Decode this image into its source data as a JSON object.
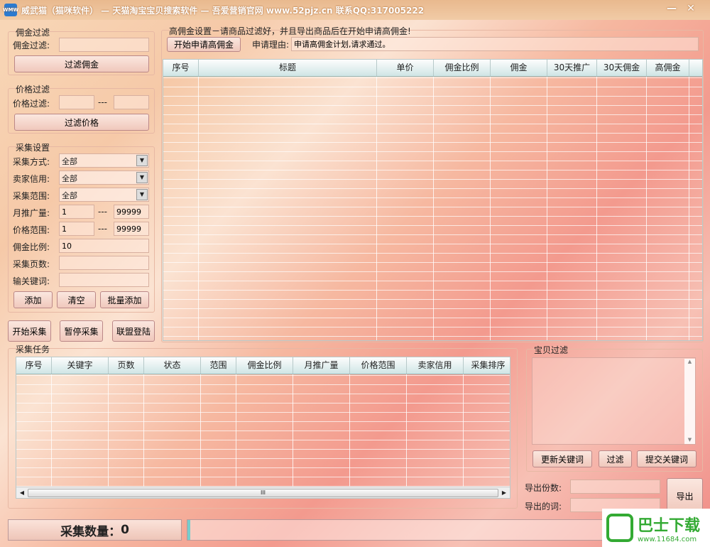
{
  "window": {
    "title": "威武猫（猫咪软件） — 天猫淘宝宝贝搜索软件 — 吾爱营销官网 www.52pjz.cn 联系QQ:317005222",
    "icon_text": "WMW",
    "minimize": "—",
    "close": "✕"
  },
  "commission_filter": {
    "group": "佣金过滤",
    "label": "佣金过滤:",
    "value": "",
    "button": "过滤佣金"
  },
  "price_filter": {
    "group": "价格过滤",
    "label": "价格过滤:",
    "min": "",
    "sep": "---",
    "max": "",
    "button": "过滤价格"
  },
  "collect_settings": {
    "group": "采集设置",
    "mode_label": "采集方式:",
    "mode": "全部",
    "credit_label": "卖家信用:",
    "credit": "全部",
    "range_label": "采集范围:",
    "range": "全部",
    "monthly_label": "月推广量:",
    "monthly_min": "1",
    "monthly_max": "99999",
    "sep": "---",
    "price_label": "价格范围:",
    "price_min": "1",
    "price_max": "99999",
    "ratio_label": "佣金比例:",
    "ratio": "10",
    "pages_label": "采集页数:",
    "pages": "",
    "keyword_label": "输关键词:",
    "keyword": "",
    "add": "添加",
    "clear": "清空",
    "batch_add": "批量添加"
  },
  "actions": {
    "start": "开始采集",
    "pause": "暂停采集",
    "login": "联盟登陆"
  },
  "high_commission": {
    "group": "高佣金设置－请商品过滤好，并且导出商品后在开始申请高佣金!",
    "button": "开始申请高佣金",
    "reason_label": "申请理由:",
    "reason": "申请高佣金计划,请求通过。"
  },
  "results_table": {
    "columns": [
      "序号",
      "标题",
      "单价",
      "佣金比例",
      "佣金",
      "30天推广",
      "30天佣金",
      "高佣金"
    ],
    "rows": []
  },
  "tasks": {
    "group": "采集任务",
    "columns": [
      "序号",
      "关键字",
      "页数",
      "状态",
      "范围",
      "佣金比例",
      "月推广量",
      "价格范围",
      "卖家信用",
      "采集排序"
    ],
    "rows": [],
    "scroll_grip": "III"
  },
  "item_filter": {
    "group": "宝贝过滤",
    "text": "",
    "update": "更新关键词",
    "filter": "过滤",
    "submit": "提交关键词"
  },
  "export": {
    "count_label": "导出份数:",
    "count": "",
    "words_label": "导出的词:",
    "words": "",
    "button": "导出"
  },
  "status": {
    "count_label": "采集数量：",
    "count": "0",
    "progress": 0
  },
  "watermark": {
    "name": "巴士下载",
    "url": "www.11684.com"
  }
}
